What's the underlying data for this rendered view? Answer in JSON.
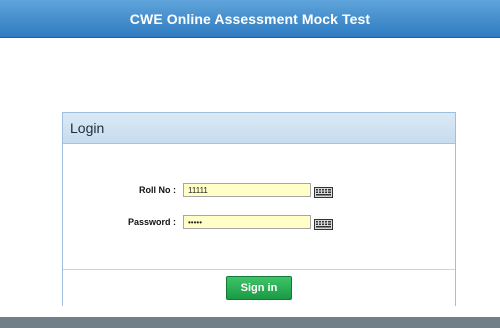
{
  "header": {
    "title": "CWE Online Assessment Mock Test"
  },
  "login_panel": {
    "title": "Login",
    "fields": {
      "roll_no": {
        "label": "Roll No :",
        "value": "11111"
      },
      "password": {
        "label": "Password :",
        "value": "•••••"
      }
    },
    "keyboard_icon": "keyboard-icon",
    "signin_label": "Sign in"
  },
  "colors": {
    "header_bg": "#2f7cc1",
    "panel_header_bg": "#c7dcef",
    "field_bg": "#ffffc7",
    "signin_bg": "#1a9a43",
    "bottom_bar": "#717f88"
  }
}
